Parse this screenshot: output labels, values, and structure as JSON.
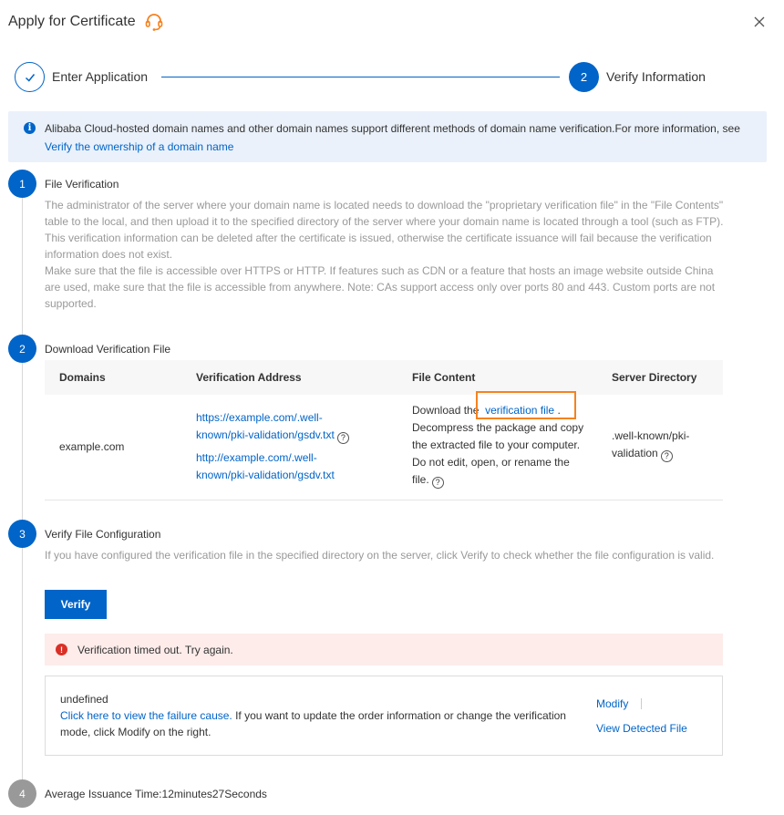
{
  "header": {
    "title": "Apply for Certificate"
  },
  "steps": {
    "step1_label": "Enter Application",
    "step2_number": "2",
    "step2_label": "Verify Information"
  },
  "info": {
    "text": "Alibaba Cloud-hosted domain names and other domain names support different methods of domain name verification.For more information, see ",
    "link": "Verify the ownership of a domain name"
  },
  "sections": {
    "s1": {
      "number": "1",
      "title": "File Verification",
      "desc1": "The administrator of the server where your domain name is located needs to download the \"proprietary verification file\" in the \"File Contents\" table to the local, and then upload it to the specified directory of the server where your domain name is located through a tool (such as FTP). This verification information can be deleted after the certificate is issued, otherwise the certificate issuance will fail because the verification information does not exist.",
      "desc2": "Make sure that the file is accessible over HTTPS or HTTP. If features such as CDN or a feature that hosts an image website outside China are used, make sure that the file is accessible from anywhere. Note: CAs support access only over ports 80 and 443. Custom ports are not supported."
    },
    "s2": {
      "number": "2",
      "title": "Download Verification File"
    },
    "s3": {
      "number": "3",
      "title": "Verify File Configuration",
      "desc": "If you have configured the verification file in the specified directory on the server, click Verify to check whether the file configuration is valid.",
      "verify_button": "Verify"
    },
    "s4": {
      "number": "4",
      "title": "Average Issuance Time:12minutes27Seconds"
    }
  },
  "table": {
    "headers": [
      "Domains",
      "Verification Address",
      "File Content",
      "Server Directory"
    ],
    "row": {
      "domain": "example.com",
      "https_url": "https://example.com/.well-known/pki-validation/gsdv.txt",
      "http_url": "http://example.com/.well-known/pki-validation/gsdv.txt",
      "content_prefix": "Download the",
      "content_link": "verification file",
      "content_suffix": ". Decompress the package and copy the extracted file to your computer. Do not edit, open, or rename the file.",
      "directory": ".well-known/pki-validation"
    }
  },
  "error": {
    "message": "Verification timed out. Try again."
  },
  "result": {
    "line1": "undefined",
    "failure_link": "Click here to view the failure cause.",
    "failure_text": " If you want to update the order information or change the verification mode, click Modify on the right.",
    "modify": "Modify",
    "detected": "View Detected File"
  },
  "colors": {
    "primary": "#0064c8",
    "error": "#d93026",
    "highlight": "#f5821f"
  }
}
